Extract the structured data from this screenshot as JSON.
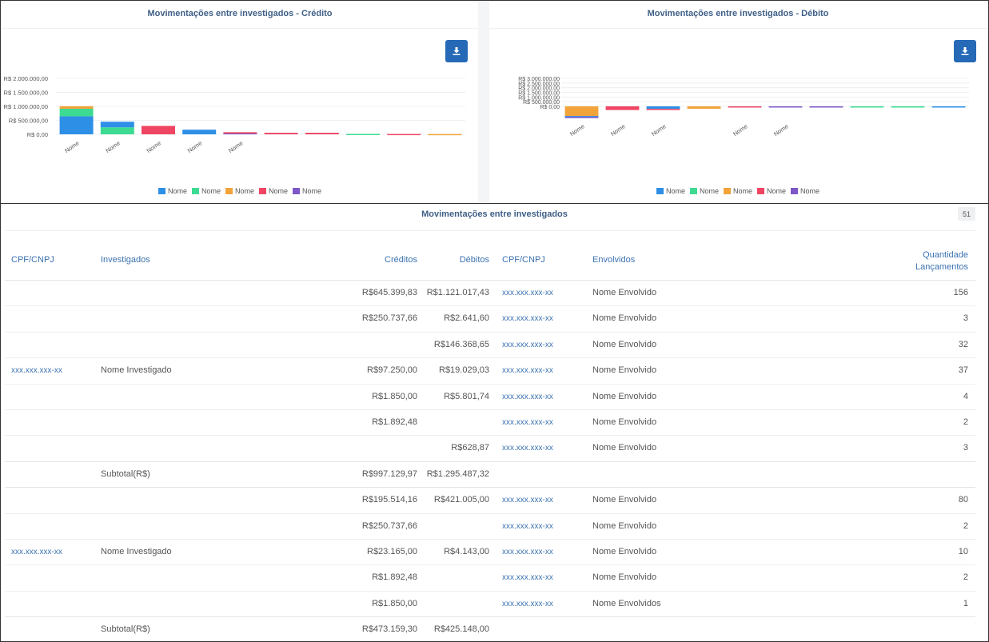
{
  "charts": {
    "credit": {
      "title": "Movimentações entre investigados - Crédito",
      "download_icon": "download-icon",
      "y_ticks": [
        "R$ 2.000.000,00",
        "R$ 1.500.000,00",
        "R$ 1.000.000,00",
        "R$ 500.000,00",
        "R$ 0,00"
      ],
      "x_labels": [
        "Nome",
        "Nome",
        "Nome",
        "Nome",
        "Nome"
      ],
      "legend": [
        "Nome",
        "Nome",
        "Nome",
        "Nome",
        "Nome"
      ]
    },
    "debit": {
      "title": "Movimentações entre investigados - Débito",
      "download_icon": "download-icon",
      "y_ticks": [
        "R$ 3.000.000,00",
        "R$ 2.500.000,00",
        "R$ 2.000.000,00",
        "R$ 1.500.000,00",
        "R$ 1.000.000,00",
        "R$ 500.000,00",
        "R$ 0,00"
      ],
      "x_labels": [
        "Nome",
        "Nome",
        "Nome",
        "Nome",
        "Nome"
      ],
      "legend": [
        "Nome",
        "Nome",
        "Nome",
        "Nome",
        "Nome"
      ]
    }
  },
  "colors": {
    "blue": "#2e8fe6",
    "green": "#3ddb92",
    "orange": "#f2a33a",
    "red": "#ef4563",
    "purple": "#7e57c9",
    "header_blue": "#3b72b0",
    "button_blue": "#2569b7"
  },
  "chart_data": [
    {
      "type": "bar",
      "stacked": true,
      "title": "Movimentações entre investigados - Crédito",
      "categories": [
        "Nome",
        "",
        "Nome",
        "",
        "Nome",
        "",
        "Nome",
        "",
        "Nome",
        "",
        "",
        "",
        "",
        "",
        "",
        "",
        "",
        ""
      ],
      "ylim": [
        0,
        2000000
      ],
      "legend_position": "bottom",
      "bars": [
        {
          "segments": [
            [
              "blue",
              645000
            ],
            [
              "green",
              270000
            ],
            [
              "orange",
              90000
            ]
          ]
        },
        {
          "segments": [
            [
              "green",
              250000
            ],
            [
              "blue",
              200000
            ]
          ]
        },
        {
          "segments": [
            [
              "red",
              300000
            ]
          ]
        },
        {
          "segments": [
            [
              "blue",
              165000
            ]
          ]
        },
        {
          "segments": [
            [
              "purple",
              50000
            ],
            [
              "red",
              25000
            ]
          ]
        },
        {
          "segments": [
            [
              "red",
              55000
            ]
          ]
        },
        {
          "segments": [
            [
              "red",
              55000
            ]
          ]
        },
        {
          "segments": [
            [
              "green",
              15000
            ]
          ]
        },
        {
          "segments": [
            [
              "red",
              12000
            ]
          ]
        },
        {
          "segments": [
            [
              "orange",
              10000
            ]
          ]
        }
      ]
    },
    {
      "type": "bar",
      "stacked": true,
      "title": "Movimentações entre investigados - Débito",
      "categories": [
        "Nome",
        "Nome",
        "Nome",
        "",
        "Nome",
        "Nome",
        "",
        "",
        "",
        ""
      ],
      "ylim": [
        0,
        3000000
      ],
      "legend_position": "bottom",
      "bars": [
        {
          "segments": [
            [
              "orange",
              -1100000
            ],
            [
              "blue",
              -100000
            ],
            [
              "purple",
              -100000
            ]
          ]
        },
        {
          "segments": [
            [
              "red",
              -420000
            ]
          ]
        },
        {
          "segments": [
            [
              "blue",
              -290000
            ],
            [
              "red",
              -60000
            ]
          ]
        },
        {
          "segments": [
            [
              "orange",
              -280000
            ]
          ]
        },
        {
          "segments": [
            [
              "red",
              -60000
            ]
          ]
        },
        {
          "segments": [
            [
              "purple",
              -30000
            ]
          ]
        },
        {
          "segments": [
            [
              "purple",
              -25000
            ]
          ]
        },
        {
          "segments": [
            [
              "green",
              -20000
            ]
          ]
        },
        {
          "segments": [
            [
              "green",
              -8000
            ]
          ]
        },
        {
          "segments": [
            [
              "blue",
              -5000
            ]
          ]
        }
      ]
    }
  ],
  "table": {
    "title": "Movimentações entre investigados",
    "count": "51",
    "headers": {
      "cpf": "CPF/CNPJ",
      "investigados": "Investigados",
      "creditos": "Créditos",
      "debitos": "Débitos",
      "cpf2": "CPF/CNPJ",
      "envolvidos": "Envolvidos",
      "quantidade_1": "Quantidade",
      "quantidade_2": "Lançamentos"
    },
    "groups": [
      {
        "cpf": "xxx.xxx.xxx-xx",
        "name": "Nome Investigado",
        "rows": [
          {
            "credito": "R$645.399,83",
            "debito": "R$1.121.017,43",
            "cpf": "xxx.xxx.xxx-xx",
            "envolvido": "Nome Envolvido",
            "qtd": "156"
          },
          {
            "credito": "R$250.737,66",
            "debito": "R$2.641,60",
            "cpf": "xxx.xxx.xxx-xx",
            "envolvido": "Nome Envolvido",
            "qtd": "3"
          },
          {
            "credito": "",
            "debito": "R$146.368,65",
            "cpf": "xxx.xxx.xxx-xx",
            "envolvido": "Nome Envolvido",
            "qtd": "32"
          },
          {
            "credito": "R$97.250,00",
            "debito": "R$19.029,03",
            "cpf": "xxx.xxx.xxx-xx",
            "envolvido": "Nome Envolvido",
            "qtd": "37"
          },
          {
            "credito": "R$1.850,00",
            "debito": "R$5.801,74",
            "cpf": "xxx.xxx.xxx-xx",
            "envolvido": "Nome Envolvido",
            "qtd": "4"
          },
          {
            "credito": "R$1.892,48",
            "debito": "",
            "cpf": "xxx.xxx.xxx-xx",
            "envolvido": "Nome Envolvido",
            "qtd": "2"
          },
          {
            "credito": "",
            "debito": "R$628,87",
            "cpf": "xxx.xxx.xxx-xx",
            "envolvido": "Nome Envolvido",
            "qtd": "3"
          }
        ],
        "subtotal_label": "Subtotal(R$)",
        "subtotal_credito": "R$997.129,97",
        "subtotal_debito": "R$1.295.487,32"
      },
      {
        "cpf": "xxx.xxx.xxx-xx",
        "name": "Nome Investigado",
        "rows": [
          {
            "credito": "R$195.514,16",
            "debito": "R$421.005,00",
            "cpf": "xxx.xxx.xxx-xx",
            "envolvido": "Nome Envolvido",
            "qtd": "80"
          },
          {
            "credito": "R$250.737,66",
            "debito": "",
            "cpf": "xxx.xxx.xxx-xx",
            "envolvido": "Nome Envolvido",
            "qtd": "2"
          },
          {
            "credito": "R$23.165,00",
            "debito": "R$4.143,00",
            "cpf": "xxx.xxx.xxx-xx",
            "envolvido": "Nome Envolvido",
            "qtd": "10"
          },
          {
            "credito": "R$1.892,48",
            "debito": "",
            "cpf": "xxx.xxx.xxx-xx",
            "envolvido": "Nome Envolvido",
            "qtd": "2"
          },
          {
            "credito": "R$1.850,00",
            "debito": "",
            "cpf": "xxx.xxx.xxx-xx",
            "envolvido": "Nome Envolvidos",
            "qtd": "1"
          }
        ],
        "subtotal_label": "Subtotal(R$)",
        "subtotal_credito": "R$473.159,30",
        "subtotal_debito": "R$425.148,00"
      }
    ]
  }
}
